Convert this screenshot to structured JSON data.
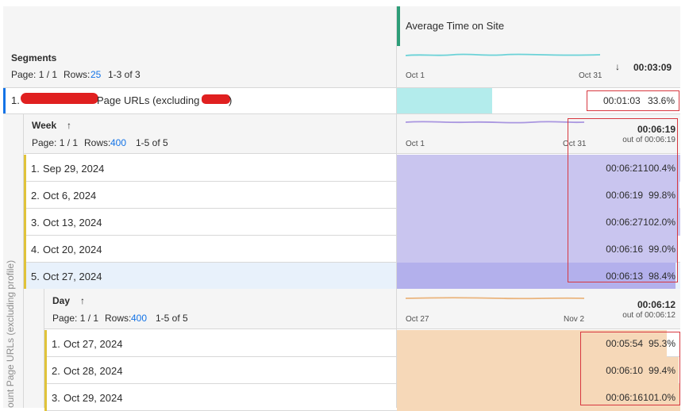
{
  "metric": {
    "name": "Average Time on Site"
  },
  "segments": {
    "title": "Segments",
    "page": "Page: 1 / 1",
    "rows_label": "Rows:",
    "rows_value": "25",
    "range": "1-3 of 3",
    "date_start": "Oct 1",
    "date_end": "Oct 31",
    "sort_icon": "arrow-down-icon",
    "total": "00:03:09"
  },
  "segment_row": {
    "index": "1.",
    "label": "Page URLs (excluding",
    "label_end": ")",
    "value": "00:01:03",
    "percent": "33.6%",
    "bar_fraction": 0.336
  },
  "week": {
    "title": "Week",
    "sort_icon": "arrow-up-icon",
    "page": "Page: 1 / 1",
    "rows_label": "Rows:",
    "rows_value": "400",
    "range": "1-5 of 5",
    "date_start": "Oct 1",
    "date_end": "Oct 31",
    "total": "00:06:19",
    "total_of": "out of 00:06:19",
    "rows": [
      {
        "index": "1.",
        "label": "Sep 29, 2024",
        "value": "00:06:21",
        "percent": "100.4%",
        "bar_fraction": 1.004
      },
      {
        "index": "2.",
        "label": "Oct 6, 2024",
        "value": "00:06:19",
        "percent": "99.8%",
        "bar_fraction": 0.998
      },
      {
        "index": "3.",
        "label": "Oct 13, 2024",
        "value": "00:06:27",
        "percent": "102.0%",
        "bar_fraction": 1.02
      },
      {
        "index": "4.",
        "label": "Oct 20, 2024",
        "value": "00:06:16",
        "percent": "99.0%",
        "bar_fraction": 0.99
      },
      {
        "index": "5.",
        "label": "Oct 27, 2024",
        "value": "00:06:13",
        "percent": "98.4%",
        "bar_fraction": 0.984
      }
    ]
  },
  "day": {
    "title": "Day",
    "sort_icon": "arrow-up-icon",
    "page": "Page: 1 / 1",
    "rows_label": "Rows:",
    "rows_value": "400",
    "range": "1-5 of 5",
    "date_start": "Oct 27",
    "date_end": "Nov 2",
    "total": "00:06:12",
    "total_of": "out of 00:06:12",
    "rows": [
      {
        "index": "1.",
        "label": "Oct 27, 2024",
        "value": "00:05:54",
        "percent": "95.3%",
        "bar_fraction": 0.953
      },
      {
        "index": "2.",
        "label": "Oct 28, 2024",
        "value": "00:06:10",
        "percent": "99.4%",
        "bar_fraction": 0.994
      },
      {
        "index": "3.",
        "label": "Oct 29, 2024",
        "value": "00:06:16",
        "percent": "101.0%",
        "bar_fraction": 1.01
      }
    ]
  },
  "side_label": "ount Page URLs (excluding profile)",
  "colors": {
    "accent_green": "#2d9d78",
    "accent_blue": "#1473e6",
    "segment_bar": "#b3ecec",
    "week_bar": "#c9c5ef",
    "week_bar_selected": "#b3b0ec",
    "day_bar": "#f6d8b8",
    "row_yellow": "#e0c33a",
    "selected_row": "#e8f1fb",
    "annotation_red": "#d7373f",
    "sparkline_segments": "#6bd2d7",
    "sparkline_week": "#a996e0",
    "sparkline_day": "#eab47c"
  }
}
